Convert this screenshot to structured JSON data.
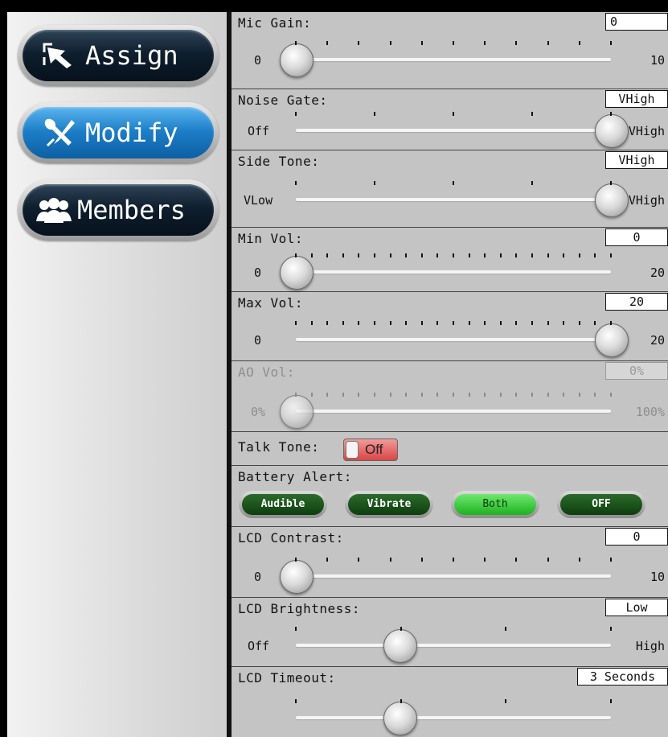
{
  "sidebar": {
    "buttons": [
      {
        "label": "Assign",
        "icon": "assign-arrow-icon",
        "active": false
      },
      {
        "label": "Modify",
        "icon": "tools-icon",
        "active": true
      },
      {
        "label": "Members",
        "icon": "members-icon",
        "active": false
      }
    ]
  },
  "settings": {
    "mic_gain": {
      "label": "Mic Gain:",
      "value": "0",
      "min": "0",
      "max": "10",
      "value_fraction": 0.0
    },
    "noise_gate": {
      "label": "Noise Gate:",
      "value": "VHigh",
      "min": "Off",
      "max": "VHigh",
      "value_fraction": 1.0
    },
    "side_tone": {
      "label": "Side Tone:",
      "value": "VHigh",
      "min": "VLow",
      "max": "VHigh",
      "value_fraction": 1.0
    },
    "min_vol": {
      "label": "Min Vol:",
      "value": "0",
      "min": "0",
      "max": "20",
      "value_fraction": 0.0
    },
    "max_vol": {
      "label": "Max Vol:",
      "value": "20",
      "min": "0",
      "max": "20",
      "value_fraction": 1.0
    },
    "ao_vol": {
      "label": "AO Vol:",
      "value": "0%",
      "min": "0%",
      "max": "100%",
      "value_fraction": 0.0,
      "disabled": true
    },
    "talk_tone": {
      "label": "Talk Tone:",
      "state": "Off"
    },
    "battery_alert": {
      "label": "Battery Alert:",
      "options": [
        "Audible",
        "Vibrate",
        "Both",
        "OFF"
      ],
      "selected": "Both"
    },
    "lcd_contrast": {
      "label": "LCD Contrast:",
      "value": "0",
      "min": "0",
      "max": "10",
      "value_fraction": 0.0
    },
    "lcd_brightness": {
      "label": "LCD Brightness:",
      "value": "Low",
      "min": "Off",
      "max": "High",
      "value_fraction": 0.33
    },
    "lcd_timeout": {
      "label": "LCD Timeout:",
      "value": "3 Seconds",
      "value_fraction": 0.33
    }
  }
}
